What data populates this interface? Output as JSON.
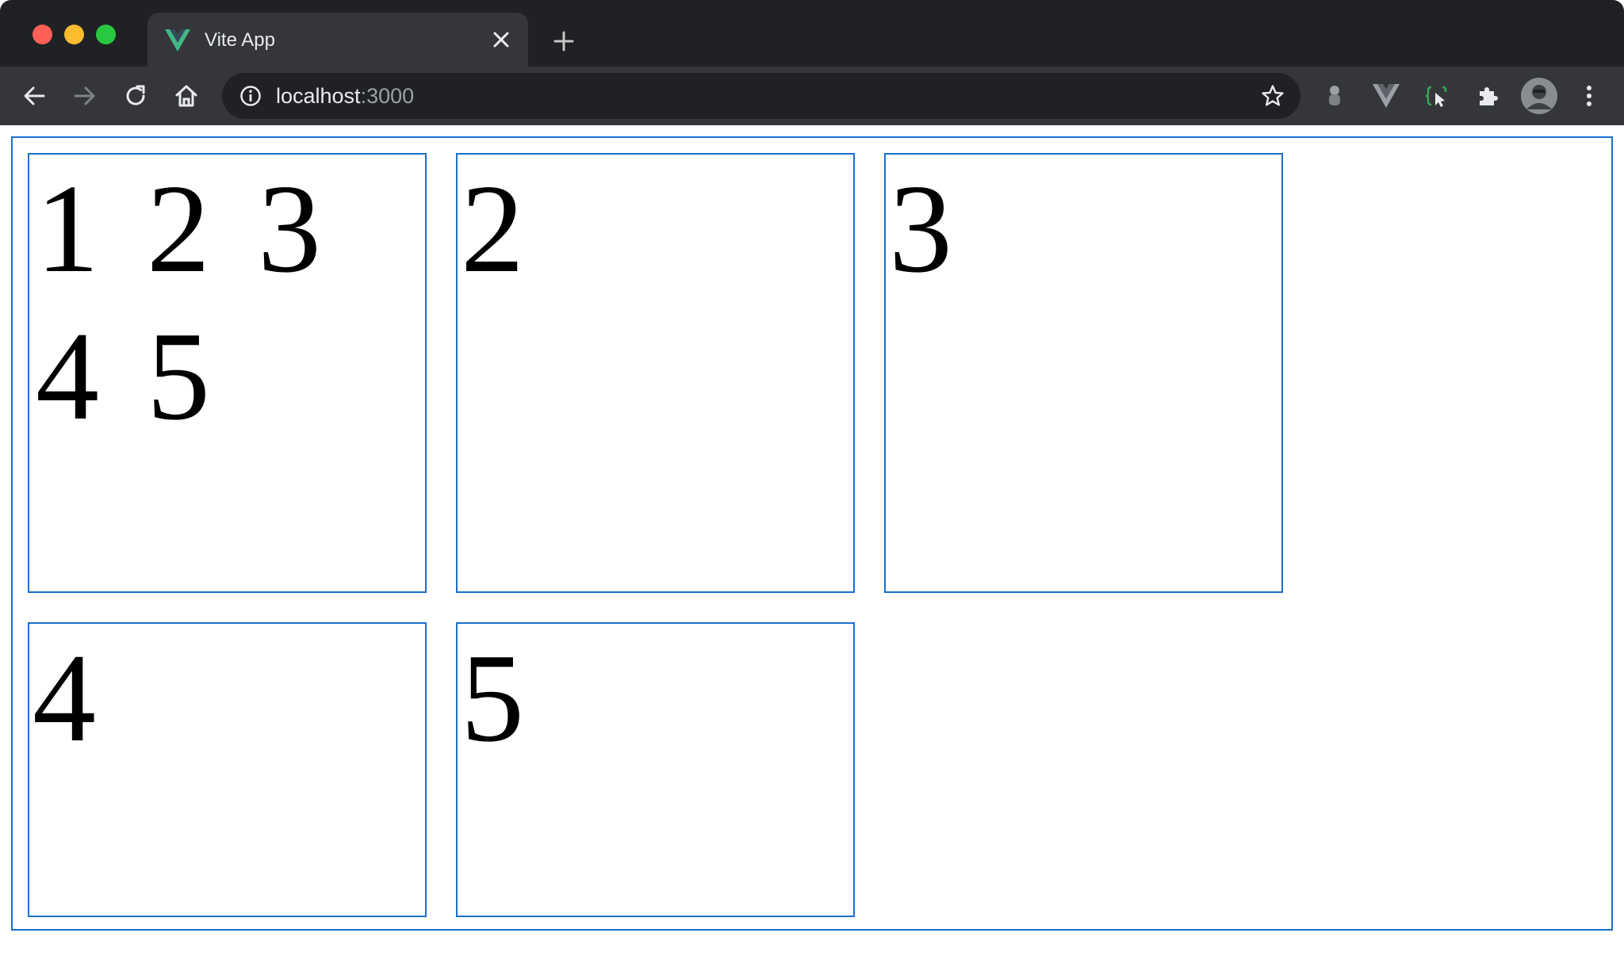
{
  "window": {
    "colors": {
      "close": "#ff5f57",
      "minimize": "#febc2e",
      "maximize": "#28c840"
    }
  },
  "tab": {
    "title": "Vite App",
    "favicon": "vue-logo-icon"
  },
  "toolbar": {
    "url_host": "localhost",
    "url_port": ":3000"
  },
  "page": {
    "accent": "#1a6fce",
    "cells": [
      {
        "text": "1 2 3 4 5"
      },
      {
        "text": "2"
      },
      {
        "text": "3"
      },
      {
        "text": "4"
      },
      {
        "text": "5"
      }
    ]
  }
}
